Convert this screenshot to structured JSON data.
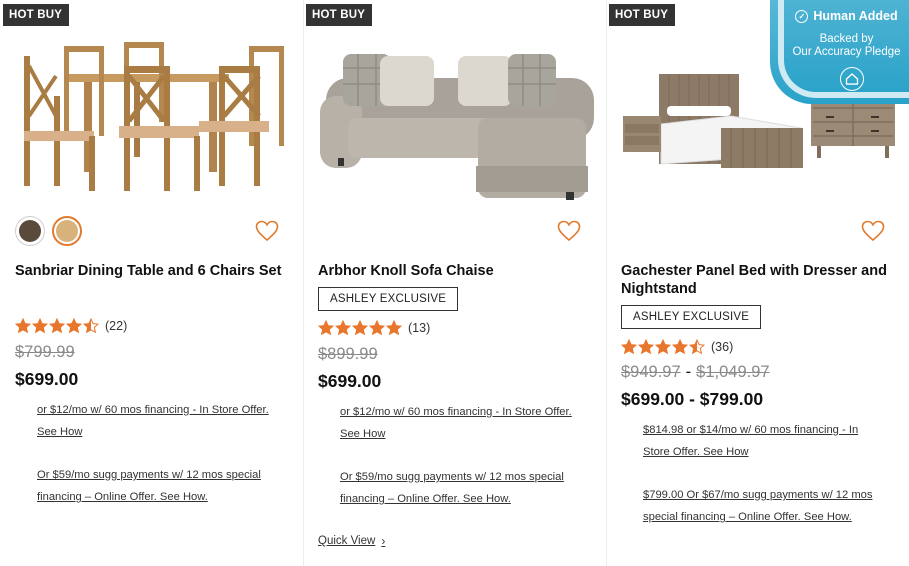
{
  "products": [
    {
      "badge": "HOT BUY",
      "title": "Sanbriar Dining Table and 6 Chairs Set",
      "rating_value": 4.5,
      "rating_count": "(22)",
      "was_price": "$799.99",
      "price": "$699.00",
      "financing_1": "or $12/mo w/ 60 mos financing - In Store Offer. See How",
      "financing_2": "Or $59/mo sugg payments w/ 12 mos special financing – Online Offer. See How.",
      "swatch_colors": [
        "#5a4a3c",
        "#d7b27a"
      ],
      "image": "dining-set-image"
    },
    {
      "badge": "HOT BUY",
      "title": "Arbhor Knoll Sofa Chaise",
      "exclusive": "ASHLEY EXCLUSIVE",
      "rating_value": 5,
      "rating_count": "(13)",
      "was_price": "$899.99",
      "price": "$699.00",
      "financing_1": "or $12/mo w/ 60 mos financing - In Store Offer. See How",
      "financing_2": "Or $59/mo sugg payments w/ 12 mos special financing – Online Offer. See How.",
      "quick_view": "Quick View",
      "image": "sofa-chaise-image"
    },
    {
      "badge": "HOT BUY",
      "title": "Gachester Panel Bed with Dresser and Nightstand",
      "exclusive": "ASHLEY EXCLUSIVE",
      "rating_value": 4.5,
      "rating_count": "(36)",
      "was_price_low": "$949.97",
      "price_dash": "-",
      "was_price_high": "$1,049.97",
      "price": "$699.00 - $799.00",
      "financing_1": "$814.98 or $14/mo w/ 60 mos financing - In Store Offer. See How",
      "financing_2": "$799.00 Or $67/mo sugg payments w/ 12 mos special financing – Online Offer. See How.",
      "image": "bedroom-set-image"
    }
  ],
  "overlay": {
    "human_added": "Human Added",
    "backed_line1": "Backed by",
    "backed_line2": "Our Accuracy Pledge"
  },
  "colors": {
    "star": "#e8762d",
    "badge_bg": "#333333",
    "overlay": "#3aa9cf",
    "heart": "#e07a2e"
  }
}
